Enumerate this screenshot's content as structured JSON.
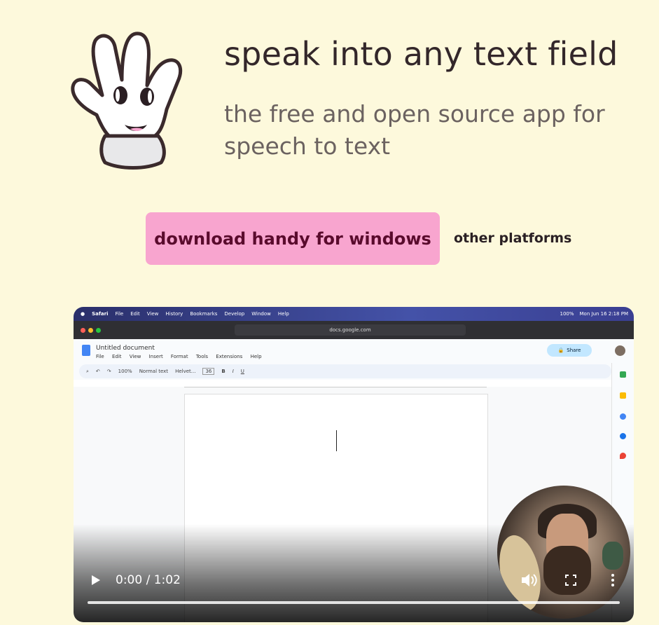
{
  "hero": {
    "title": "speak into any text field",
    "subtitle": "the free and open source app for speech to text"
  },
  "cta": {
    "download_label": "download handy for windows",
    "other_label": "other platforms"
  },
  "colors": {
    "background": "#fdf9dc",
    "button": "#f8a5cf",
    "button_text": "#5a0b2d"
  },
  "video": {
    "time": "0:00 / 1:02",
    "progress": 0,
    "mac_menu": [
      "Safari",
      "File",
      "Edit",
      "View",
      "History",
      "Bookmarks",
      "Develop",
      "Window",
      "Help"
    ],
    "status_battery": "100%",
    "status_date": "Mon Jun 16  2:18 PM",
    "url": "docs.google.com",
    "doc_title": "Untitled document",
    "doc_menu": [
      "File",
      "Edit",
      "View",
      "Insert",
      "Format",
      "Tools",
      "Extensions",
      "Help"
    ],
    "share_label": "Share",
    "toolbar": {
      "zoom": "100%",
      "style": "Normal text",
      "font": "Helvet...",
      "size": "36"
    }
  }
}
